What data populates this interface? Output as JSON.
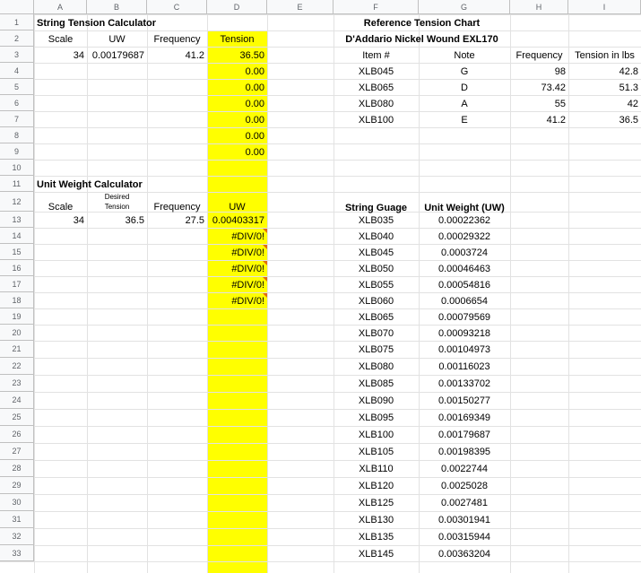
{
  "columns": [
    "A",
    "B",
    "C",
    "D",
    "E",
    "F",
    "G",
    "H",
    "I"
  ],
  "rows": [
    "1",
    "2",
    "3",
    "4",
    "5",
    "6",
    "7",
    "8",
    "9",
    "10",
    "11",
    "12",
    "13",
    "14",
    "15",
    "16",
    "17",
    "18",
    "19",
    "20",
    "21",
    "22",
    "23",
    "24",
    "25",
    "26",
    "27",
    "28",
    "29",
    "30",
    "31",
    "32",
    "33"
  ],
  "highlight_color": "#ffff00",
  "error_marker_color": "#e26b0a",
  "tension_calc": {
    "title": "String Tension Calculator",
    "headers": {
      "scale": "Scale",
      "uw": "UW",
      "frequency": "Frequency",
      "tension": "Tension"
    },
    "input": {
      "scale": "34",
      "uw": "0.00179687",
      "frequency": "41.2"
    },
    "tension_values": [
      "36.50",
      "0.00",
      "0.00",
      "0.00",
      "0.00",
      "0.00",
      "0.00"
    ]
  },
  "uw_calc": {
    "title": "Unit Weight Calculator",
    "headers": {
      "scale": "Scale",
      "desired": "Desired",
      "tension": "Tension",
      "frequency": "Frequency",
      "uw": "UW"
    },
    "input": {
      "scale": "34",
      "tension": "36.5",
      "frequency": "27.5"
    },
    "uw_values": [
      "0.00403317",
      "#DIV/0!",
      "#DIV/0!",
      "#DIV/0!",
      "#DIV/0!",
      "#DIV/0!"
    ]
  },
  "reference": {
    "title": "Reference Tension Chart",
    "subtitle": "D'Addario Nickel Wound EXL170",
    "headers": {
      "item": "Item #",
      "note": "Note",
      "frequency": "Frequency",
      "tension": "Tension in lbs"
    },
    "rows": [
      {
        "item": "XLB045",
        "note": "G",
        "frequency": "98",
        "tension": "42.8"
      },
      {
        "item": "XLB065",
        "note": "D",
        "frequency": "73.42",
        "tension": "51.3"
      },
      {
        "item": "XLB080",
        "note": "A",
        "frequency": "55",
        "tension": "42"
      },
      {
        "item": "XLB100",
        "note": "E",
        "frequency": "41.2",
        "tension": "36.5"
      }
    ]
  },
  "gauge_table": {
    "headers": {
      "gauge": "String Guage",
      "uw": "Unit Weight (UW)"
    },
    "rows": [
      {
        "gauge": "XLB035",
        "uw": "0.00022362"
      },
      {
        "gauge": "XLB040",
        "uw": "0.00029322"
      },
      {
        "gauge": "XLB045",
        "uw": "0.0003724"
      },
      {
        "gauge": "XLB050",
        "uw": "0.00046463"
      },
      {
        "gauge": "XLB055",
        "uw": "0.00054816"
      },
      {
        "gauge": "XLB060",
        "uw": "0.0006654"
      },
      {
        "gauge": "XLB065",
        "uw": "0.00079569"
      },
      {
        "gauge": "XLB070",
        "uw": "0.00093218"
      },
      {
        "gauge": "XLB075",
        "uw": "0.00104973"
      },
      {
        "gauge": "XLB080",
        "uw": "0.00116023"
      },
      {
        "gauge": "XLB085",
        "uw": "0.00133702"
      },
      {
        "gauge": "XLB090",
        "uw": "0.00150277"
      },
      {
        "gauge": "XLB095",
        "uw": "0.00169349"
      },
      {
        "gauge": "XLB100",
        "uw": "0.00179687"
      },
      {
        "gauge": "XLB105",
        "uw": "0.00198395"
      },
      {
        "gauge": "XLB110",
        "uw": "0.0022744"
      },
      {
        "gauge": "XLB120",
        "uw": "0.0025028"
      },
      {
        "gauge": "XLB125",
        "uw": "0.0027481"
      },
      {
        "gauge": "XLB130",
        "uw": "0.00301941"
      },
      {
        "gauge": "XLB135",
        "uw": "0.00315944"
      },
      {
        "gauge": "XLB145",
        "uw": "0.00363204"
      }
    ]
  }
}
